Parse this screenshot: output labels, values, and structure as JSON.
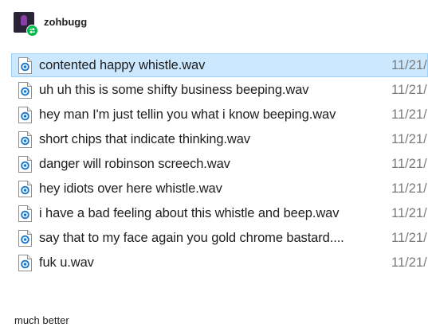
{
  "post": {
    "username": "zohbugg",
    "caption": "much better"
  },
  "files": [
    {
      "name": "contented happy whistle.wav",
      "date": "11/21/",
      "selected": true
    },
    {
      "name": "uh uh this is some shifty business beeping.wav",
      "date": "11/21/",
      "selected": false
    },
    {
      "name": "hey man I'm just tellin you what i know beeping.wav",
      "date": "11/21/",
      "selected": false
    },
    {
      "name": "short chips that indicate thinking.wav",
      "date": "11/21/",
      "selected": false
    },
    {
      "name": "danger will robinson screech.wav",
      "date": "11/21/",
      "selected": false
    },
    {
      "name": "hey idiots over here whistle.wav",
      "date": "11/21/",
      "selected": false
    },
    {
      "name": "i have a bad feeling about this whistle and beep.wav",
      "date": "11/21/",
      "selected": false
    },
    {
      "name": "say that to my face again you gold chrome bastard....",
      "date": "11/21/",
      "selected": false
    },
    {
      "name": "fuk u.wav",
      "date": "11/21/",
      "selected": false
    }
  ],
  "icons": {
    "avatar": "avatar-icon",
    "reblog_badge": "reblog-icon",
    "file": "audio-file-icon"
  },
  "colors": {
    "selection_background": "#cce8ff",
    "selection_border": "#99d1ff",
    "reblog_green": "#00b84a",
    "file_icon_blue": "#1979ca"
  }
}
